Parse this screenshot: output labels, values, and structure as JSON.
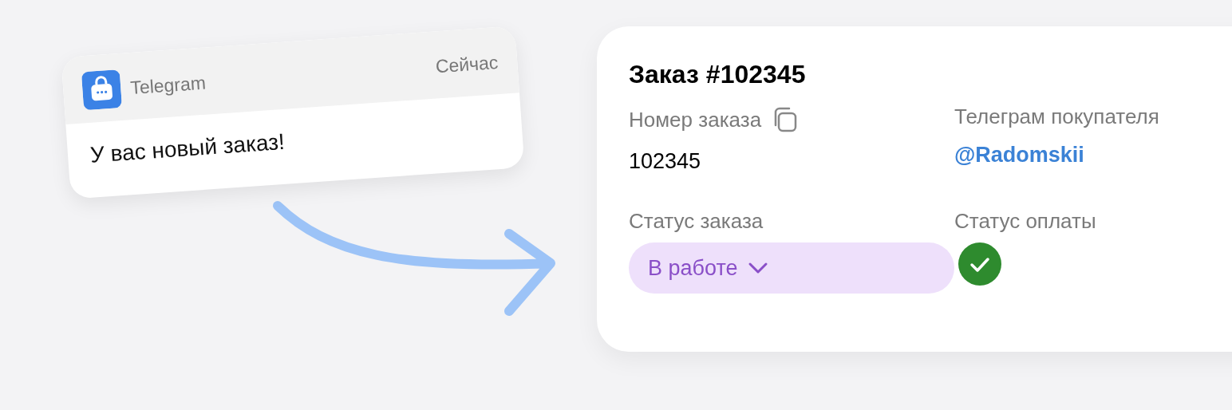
{
  "notification": {
    "app": "Telegram",
    "time": "Сейчас",
    "message": "У вас новый заказ!"
  },
  "order": {
    "title": "Заказ #102345",
    "fields": [
      {
        "kind": "copy",
        "label": "Номер заказа",
        "value": "102345"
      },
      {
        "kind": "link",
        "label": "Телеграм покупателя",
        "value": "@Radomskii"
      },
      {
        "kind": "dropdown",
        "label": "Статус заказа",
        "value": "В работе"
      },
      {
        "kind": "payment",
        "label": "Статус оплаты",
        "paid": true
      }
    ]
  }
}
